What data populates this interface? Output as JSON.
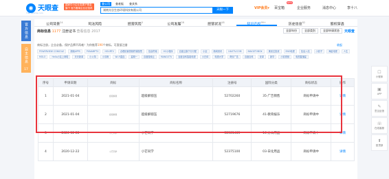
{
  "brand": {
    "logo_text": "天眼查",
    "logo_sub": "TianYanCha.com",
    "promo": "国家中小企业发展子基金旗下 官方备案企业征信机构"
  },
  "search": {
    "tabs": [
      "查公司",
      "查老板",
      "查关系"
    ],
    "value": "湖南光谷生态环境科技有限公司",
    "button": "天眼一下"
  },
  "nav": {
    "vip": "VIP会员",
    "vip_suffix": "▾",
    "app": "百宝箱",
    "new_badge": "NEW",
    "service": "企业服务",
    "news": "消息中心",
    "user": "李十八"
  },
  "left_tabs": {
    "primary": "官方信息",
    "secondary": "自主信息",
    "count": "17"
  },
  "tabs": [
    {
      "label": "公司背景",
      "count": "24"
    },
    {
      "label": "司法风险",
      "count": ""
    },
    {
      "label": "经营风险",
      "count": "0"
    },
    {
      "label": "公司发展",
      "count": "28"
    },
    {
      "label": "经营状况",
      "count": "18"
    },
    {
      "label": "知识产权",
      "count": "99+"
    },
    {
      "label": "历史信息",
      "count": "82"
    },
    {
      "label": "股权穿透",
      "count": ""
    }
  ],
  "section": {
    "title": "商标信息",
    "count": "1177",
    "sub": "注册证书",
    "download": "查看信息 2017",
    "filters": [
      "全部年份",
      "全部类别",
      "全部申请状态"
    ],
    "brand": "天眼查"
  },
  "note": {
    "prefix": "商标注册，企业必备，保护品牌不再难！为你推荐",
    "num": "190",
    "suffix": "个商标，可直接注册",
    "collapse": "收起"
  },
  "chips": [
    "POWERVIEW CONSOLE",
    "湘赣APPS",
    "PUNAMPTV",
    "HOURTV",
    "合理设置视频终端权限",
    "信息终端",
    "HC小程序",
    "百度云旗下分分配",
    "小迈",
    "新闻资讯",
    "HAOTV.COM",
    "MAIGETVBOX",
    "美景达投资",
    "ENG电视",
    "信息入站",
    "小影子",
    "海星电视",
    "人生",
    "MOLO",
    "Hello小友上网啦",
    "天天新闻",
    "小火特",
    "小清晰",
    "Wi-Fi直连",
    "星期一",
    "百度搜索云",
    "MANGOTV",
    "百度百科智能电视",
    "小白体",
    "电视大学",
    "奇妙广告",
    "百度百科",
    "安卓",
    "新华",
    "小影视频",
    "电视直播星"
  ],
  "table": {
    "headers": [
      "序号",
      "申请日期",
      "商标",
      "商标名称",
      "注册号",
      "国际分类",
      "商标状态",
      "操作"
    ],
    "rows": [
      {
        "no": "1",
        "date": "2021-01-04",
        "thumb": "超级解锁",
        "name": "超级解锁压",
        "reg": "52702260",
        "cls": "35-广告销售",
        "status": "商标申请中",
        "op": "详情"
      },
      {
        "no": "2",
        "date": "2021-01-04",
        "thumb": "超级解锁",
        "name": "超级解锁压",
        "reg": "52719676",
        "cls": "41-教育娱乐",
        "status": "商标申请中",
        "op": "详情"
      },
      {
        "no": "3",
        "date": "2020-12-22",
        "thumb": "小芒同学",
        "name": "小芒同学",
        "reg": "52381483",
        "cls": "16-办公用品",
        "status": "商标申请中",
        "op": "详情"
      },
      {
        "no": "4",
        "date": "2020-12-22",
        "thumb": "小芒同学",
        "name": "小芒同学",
        "reg": "52375100",
        "cls": "03-日化用品",
        "status": "商标申请中",
        "op": "详情"
      }
    ]
  },
  "right_bar": [
    {
      "icon": "☐",
      "label": "小程序"
    },
    {
      "icon": "▣",
      "label": "APP"
    },
    {
      "icon": "✎",
      "label": "意见反馈"
    },
    {
      "icon": "☏",
      "label": "在线客服"
    },
    {
      "icon": "⬆",
      "label": "回顶部"
    }
  ]
}
